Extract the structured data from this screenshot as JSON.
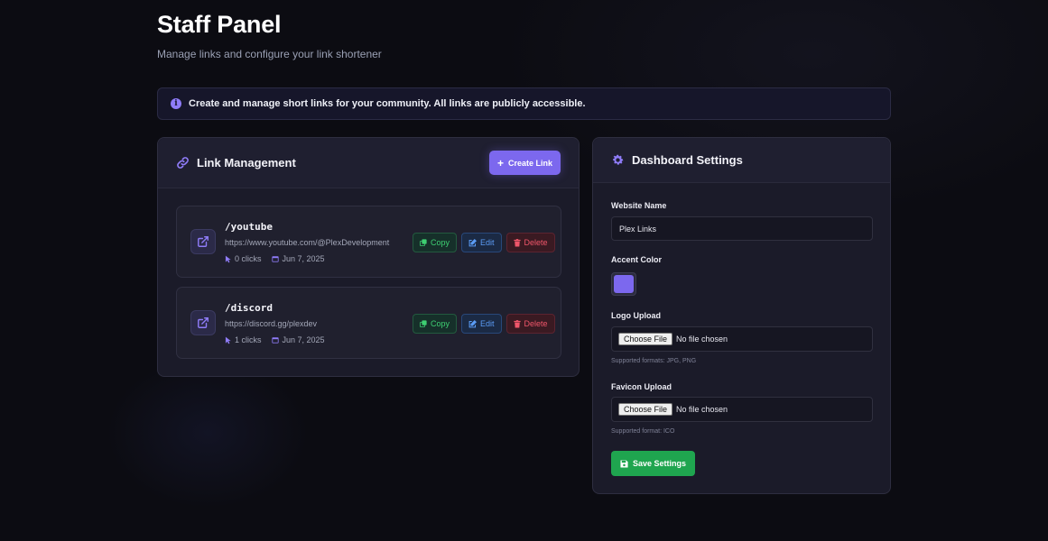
{
  "header": {
    "title": "Staff Panel",
    "subtitle": "Manage links and configure your link shortener"
  },
  "info": {
    "icon": "info-icon",
    "text": "Create and manage short links for your community. All links are publicly accessible."
  },
  "link_management": {
    "title": "Link Management",
    "icon": "link-icon",
    "create_label": "Create Link",
    "links": [
      {
        "slug": "/youtube",
        "url": "https://www.youtube.com/@PlexDevelopment",
        "clicks": "0 clicks",
        "date": "Jun 7, 2025"
      },
      {
        "slug": "/discord",
        "url": "https://discord.gg/plexdev",
        "clicks": "1 clicks",
        "date": "Jun 7, 2025"
      }
    ],
    "actions": {
      "copy": "Copy",
      "edit": "Edit",
      "delete": "Delete"
    }
  },
  "settings": {
    "title": "Dashboard Settings",
    "icon": "gear-icon",
    "website_name_label": "Website Name",
    "website_name_value": "Plex Links",
    "accent_label": "Accent Color",
    "accent_value": "#7c68ee",
    "logo_label": "Logo Upload",
    "logo_hint": "Supported formats: JPG, PNG",
    "favicon_label": "Favicon Upload",
    "favicon_hint": "Supported format: ICO",
    "choose_file": "Choose File",
    "no_file": "No file chosen",
    "save_label": "Save Settings"
  },
  "colors": {
    "accent": "#7c68ee",
    "copy": "#3ecf72",
    "edit": "#5b9cf5",
    "delete": "#f0566a",
    "save": "#1fa54f"
  }
}
